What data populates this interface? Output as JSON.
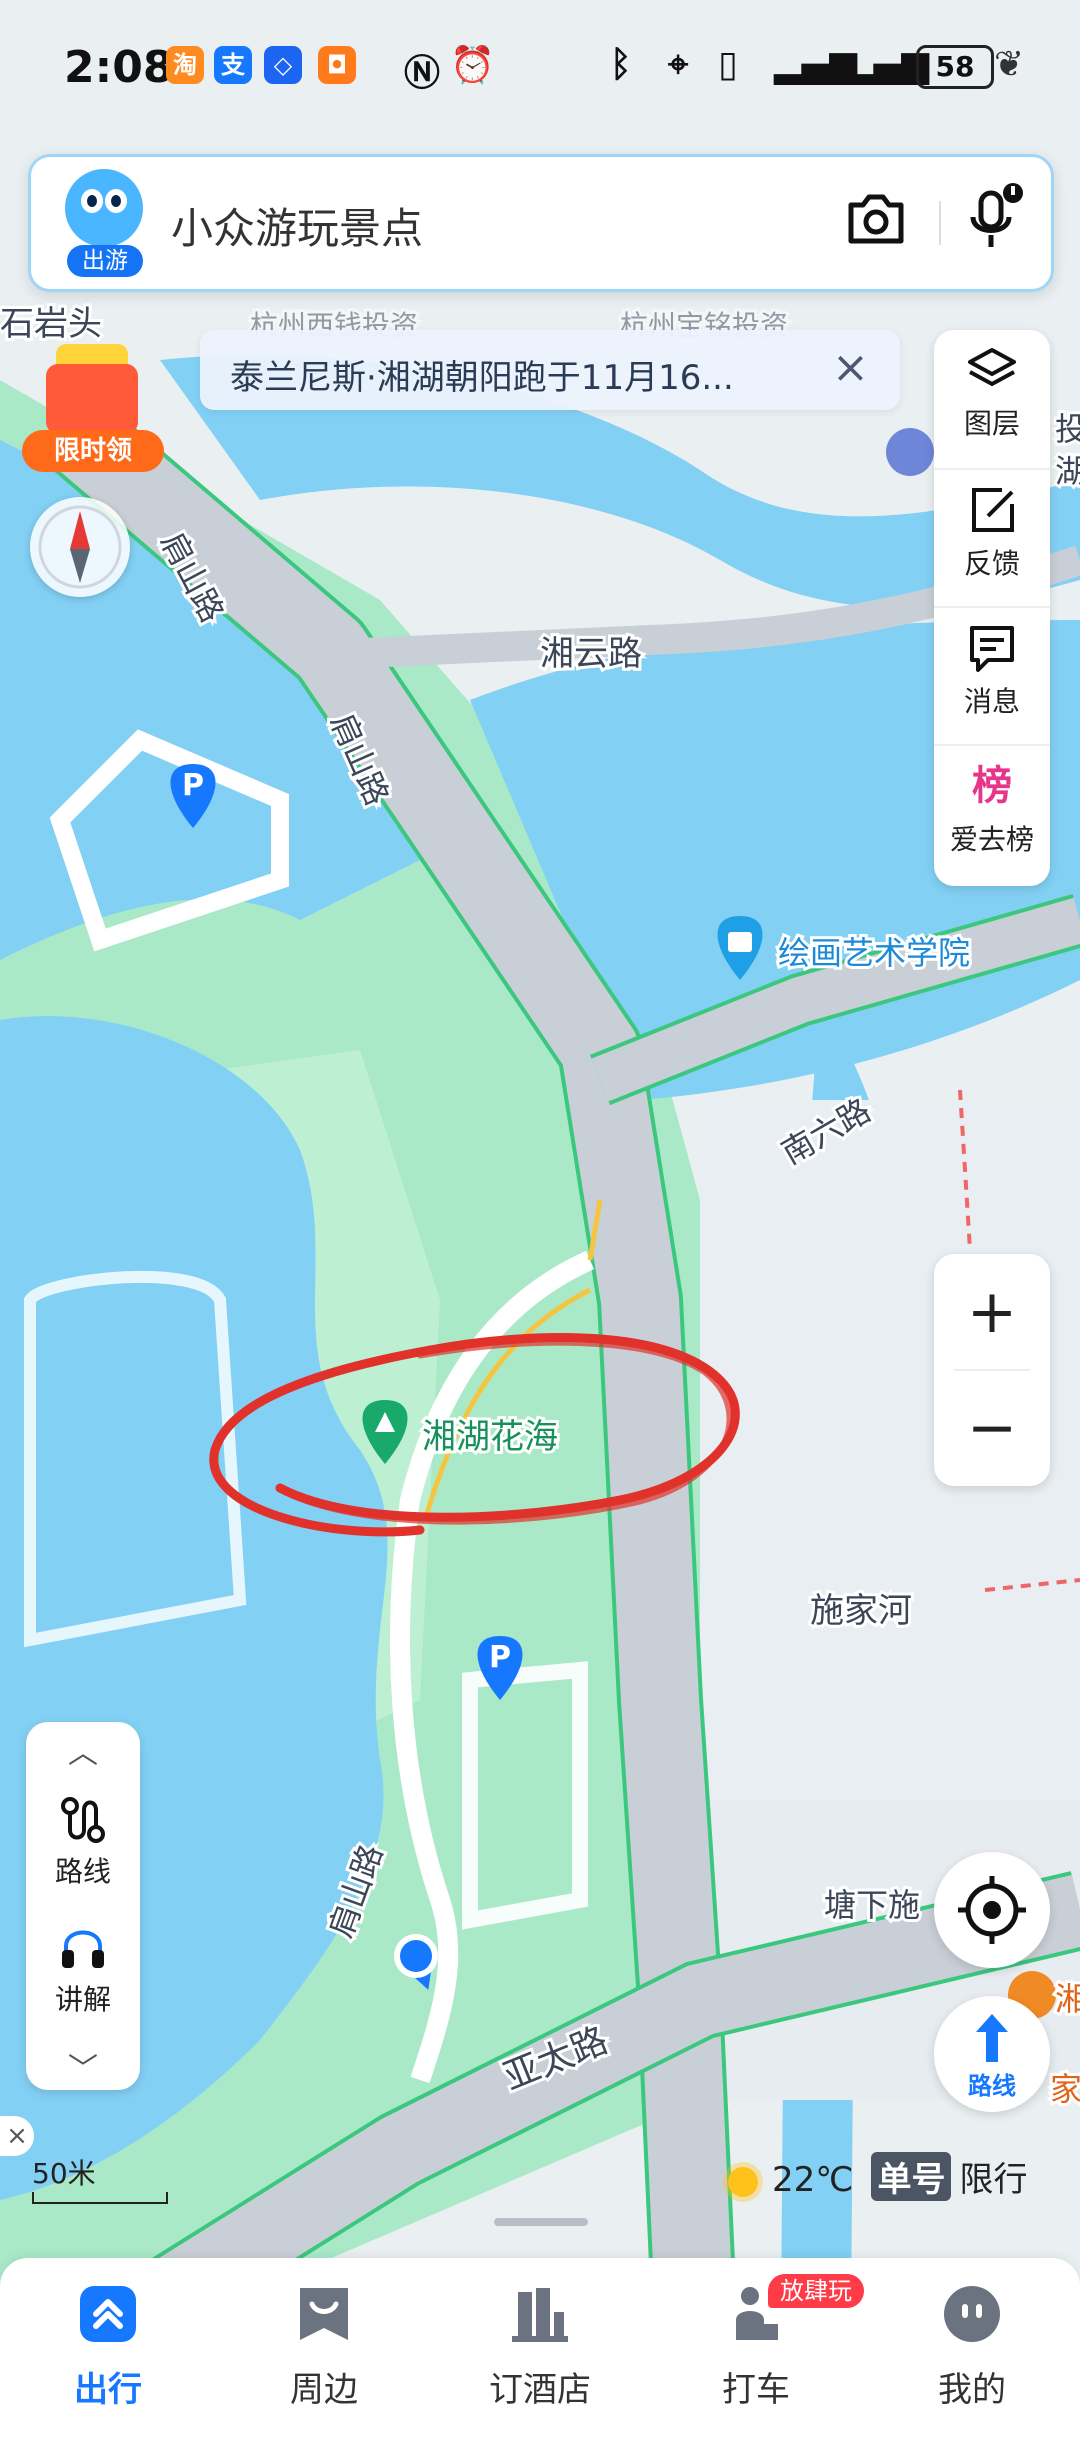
{
  "status_bar": {
    "time": "2:08",
    "battery": "58",
    "apps": [
      "taobao",
      "alipay",
      "ai",
      "jd"
    ]
  },
  "search": {
    "badge": "出游",
    "query": "小众游玩景点",
    "camera_icon": "camera-icon",
    "mic_icon": "microphone-icon"
  },
  "notice": {
    "text": "泰兰尼斯·湘湖朝阳跑于11月16...",
    "close": "×"
  },
  "promo": {
    "label": "限时领"
  },
  "right_panel": {
    "items": [
      {
        "label": "图层",
        "icon": "layers-icon"
      },
      {
        "label": "反馈",
        "icon": "edit-icon"
      },
      {
        "label": "消息",
        "icon": "message-icon"
      },
      {
        "label": "爱去榜",
        "icon": "ranking-icon",
        "glyph": "榜"
      }
    ]
  },
  "zoom": {
    "in": "+",
    "out": "−"
  },
  "route_button": {
    "label": "路线"
  },
  "left_panel": {
    "up": "︿",
    "down": "﹀",
    "items": [
      {
        "label": "路线",
        "icon": "route-icon"
      },
      {
        "label": "讲解",
        "icon": "headphones-icon"
      }
    ]
  },
  "scale": {
    "label": "50米"
  },
  "weather": {
    "temp": "22℃",
    "odd": "单号",
    "limit": "限行"
  },
  "map": {
    "labels": {
      "shishantou": "石岩头",
      "road_jianshan_1": "肩山路",
      "road_jianshan_2": "肩山路",
      "road_jianshan_3": "肩山路",
      "xiangyun": "湘云路",
      "nanliu": "南六路",
      "art_school": "绘画艺术学院",
      "xianghu_flower": "湘湖花海",
      "shijiahe": "施家河",
      "tangxia": "塘下施",
      "yatai": "亚太路",
      "partial_top": "杭州西钱投资",
      "partial_top2": "杭州宝铭投资",
      "edge_right1": "投",
      "edge_right2": "湖",
      "edge_right3": "家",
      "edge_right4": "湘"
    },
    "colors": {
      "water": "#83d0f5",
      "green": "#a9e9c8",
      "road": "#c9cfd6",
      "road_edge": "#3bc87e",
      "highlight": "#e0322b",
      "path_yellow": "#f5c542"
    }
  },
  "tabs": [
    {
      "label": "出行",
      "icon": "travel-icon",
      "active": true
    },
    {
      "label": "周边",
      "icon": "nearby-icon"
    },
    {
      "label": "订酒店",
      "icon": "hotel-icon"
    },
    {
      "label": "打车",
      "icon": "taxi-icon",
      "badge": "放肆玩"
    },
    {
      "label": "我的",
      "icon": "profile-icon"
    }
  ]
}
